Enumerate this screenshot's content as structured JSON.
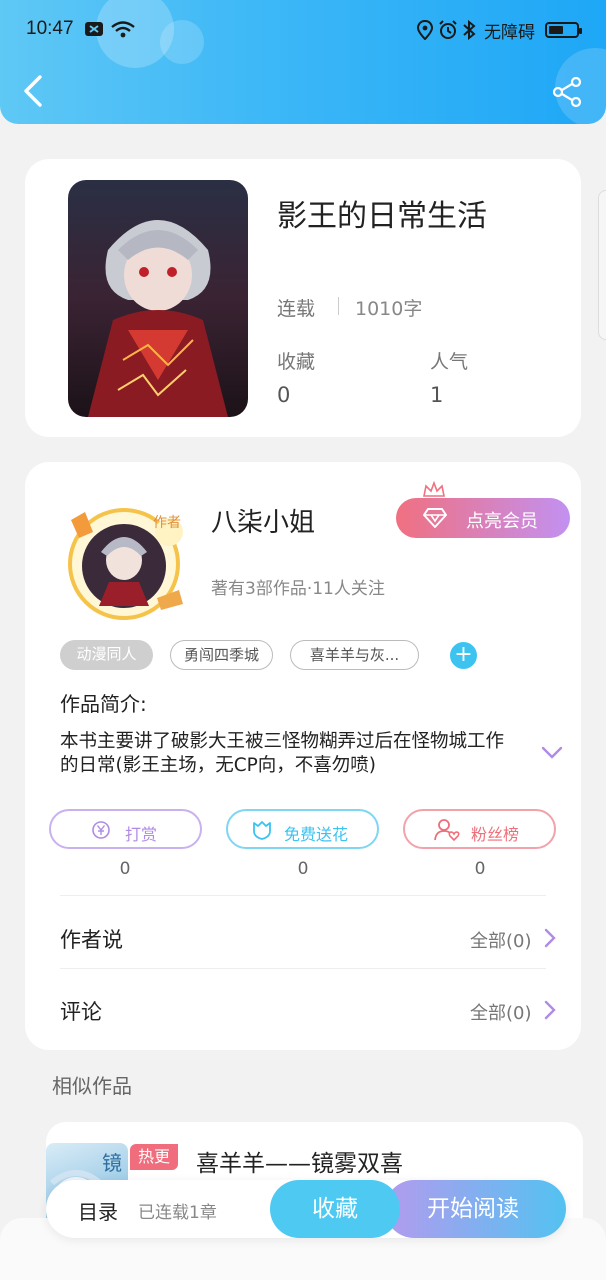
{
  "status_bar": {
    "time": "10:47",
    "accessibility_label": "无障碍",
    "battery_level": 0.55
  },
  "book": {
    "title": "影王的日常生活",
    "status": "连载",
    "word_count": "1010字",
    "stats": [
      {
        "label": "收藏",
        "value": "0"
      },
      {
        "label": "人气",
        "value": "1"
      }
    ]
  },
  "author": {
    "badge": "作者",
    "name": "八柒小姐",
    "meta": "著有3部作品·11人关注",
    "vip_button": "点亮会员"
  },
  "tags": [
    "动漫同人",
    "勇闯四季城",
    "喜羊羊与灰..."
  ],
  "intro": {
    "title": "作品简介:",
    "text": "本书主要讲了破影大王被三怪物糊弄过后在怪物城工作的日常(影王主场，无CP向，不喜勿喷)"
  },
  "actions": [
    {
      "label": "打赏",
      "count": "0",
      "color": "#b08be6"
    },
    {
      "label": "免费送花",
      "count": "0",
      "color": "#3cc3f0"
    },
    {
      "label": "粉丝榜",
      "count": "0",
      "color": "#ee6f7a"
    }
  ],
  "rows": [
    {
      "title": "作者说",
      "right": "全部(0)"
    },
    {
      "title": "评论",
      "right": "全部(0)"
    }
  ],
  "similar": {
    "section_title": "相似作品",
    "badge": "热更",
    "cover_text": "镜",
    "title": "喜羊羊——镜雾双喜"
  },
  "bottom_bar": {
    "toc": "目录",
    "toc_sub": "已连载1章",
    "favorite": "收藏",
    "start_reading": "开始阅读"
  },
  "colors": {
    "header_start": "#5fc8f5",
    "header_end": "#1ea7f6",
    "accent_purple": "#b08be6",
    "accent_blue": "#3cc3f0",
    "accent_pink": "#ee6f7a"
  }
}
